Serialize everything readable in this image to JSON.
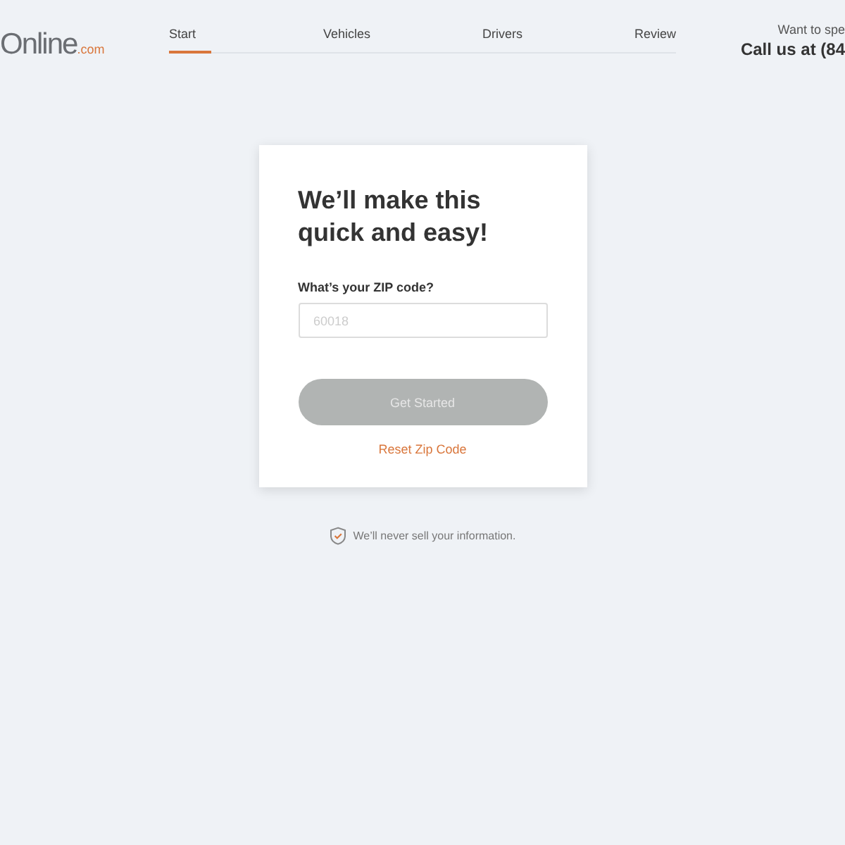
{
  "logo": {
    "name": "Online",
    "suffix": ".com"
  },
  "steps": [
    {
      "label": "Start",
      "selected": true
    },
    {
      "label": "Vehicles",
      "selected": false
    },
    {
      "label": "Drivers",
      "selected": false
    },
    {
      "label": "Review",
      "selected": false
    }
  ],
  "contact": {
    "prompt": "Want to spe",
    "phone": "Call us at (84"
  },
  "card": {
    "title": "We’ll make this quick and easy!",
    "zip_label": "What’s your ZIP code?",
    "zip_placeholder": "60018",
    "button": {
      "label": "Get Started",
      "disabled": true
    },
    "reset_link": "Reset Zip Code"
  },
  "privacy_note": "We’ll never sell your information."
}
